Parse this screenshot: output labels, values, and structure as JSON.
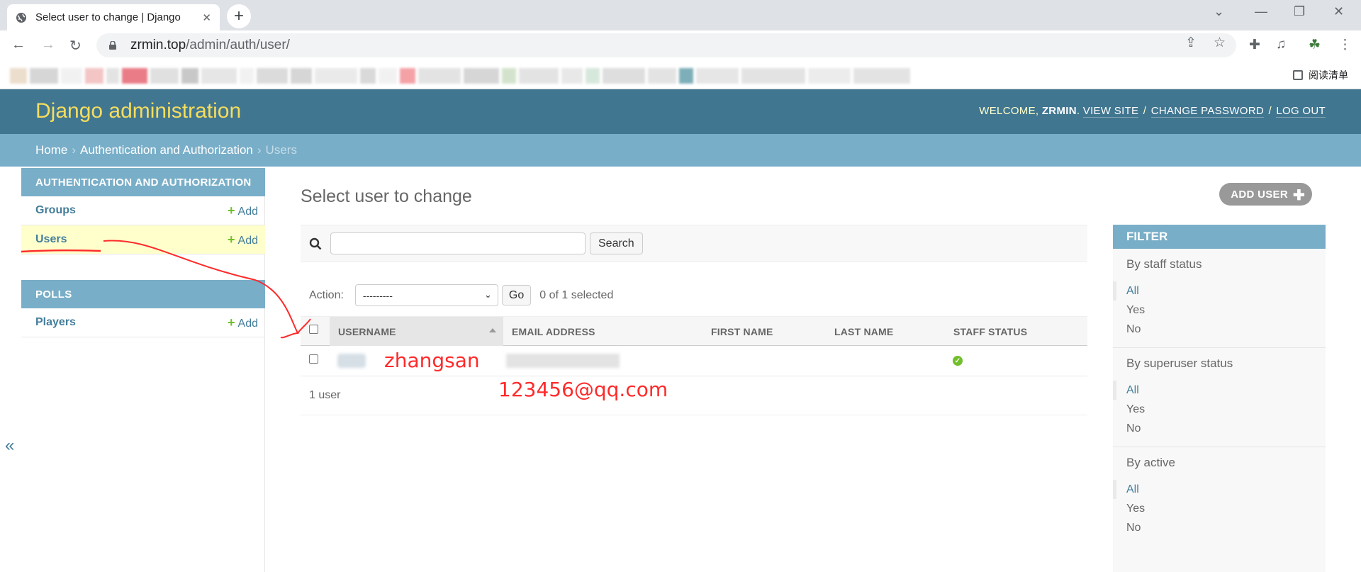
{
  "browser": {
    "tab_title": "Select user to change | Django",
    "url_domain": "zrmin.top",
    "url_path": "/admin/auth/user/",
    "reading_list_label": "阅读清单"
  },
  "header": {
    "branding": "Django administration",
    "welcome": "WELCOME,",
    "username": "ZRMIN",
    "view_site": "VIEW SITE",
    "change_password": "CHANGE PASSWORD",
    "log_out": "LOG OUT"
  },
  "breadcrumbs": {
    "home": "Home",
    "app": "Authentication and Authorization",
    "current": "Users",
    "sep": "›"
  },
  "sidebar": {
    "modules": [
      {
        "caption": "AUTHENTICATION AND AUTHORIZATION",
        "rows": [
          {
            "name": "Groups",
            "add": "Add"
          },
          {
            "name": "Users",
            "add": "Add"
          }
        ]
      },
      {
        "caption": "POLLS",
        "rows": [
          {
            "name": "Players",
            "add": "Add"
          }
        ]
      }
    ],
    "collapse": "«"
  },
  "content": {
    "title": "Select user to change",
    "add_user": "ADD USER",
    "search_button": "Search",
    "action_label": "Action:",
    "action_selected": "---------",
    "go_button": "Go",
    "selection_count": "0 of 1 selected",
    "columns": [
      "USERNAME",
      "EMAIL ADDRESS",
      "FIRST NAME",
      "LAST NAME",
      "STAFF STATUS"
    ],
    "paginator": "1 user"
  },
  "filter": {
    "title": "FILTER",
    "groups": [
      {
        "title": "By staff status",
        "options": [
          "All",
          "Yes",
          "No"
        ]
      },
      {
        "title": "By superuser status",
        "options": [
          "All",
          "Yes",
          "No"
        ]
      },
      {
        "title": "By active",
        "options": [
          "All",
          "Yes",
          "No"
        ]
      }
    ]
  },
  "annotations": {
    "username": "zhangsan",
    "email": "123456@qq.com"
  },
  "colors": {
    "header_bg": "#417690",
    "breadcrumb_bg": "#79aec8",
    "branding": "#f5dd5d",
    "link": "#447e9b",
    "add_green": "#70bf2b",
    "annotation_red": "#ff2a2a"
  }
}
